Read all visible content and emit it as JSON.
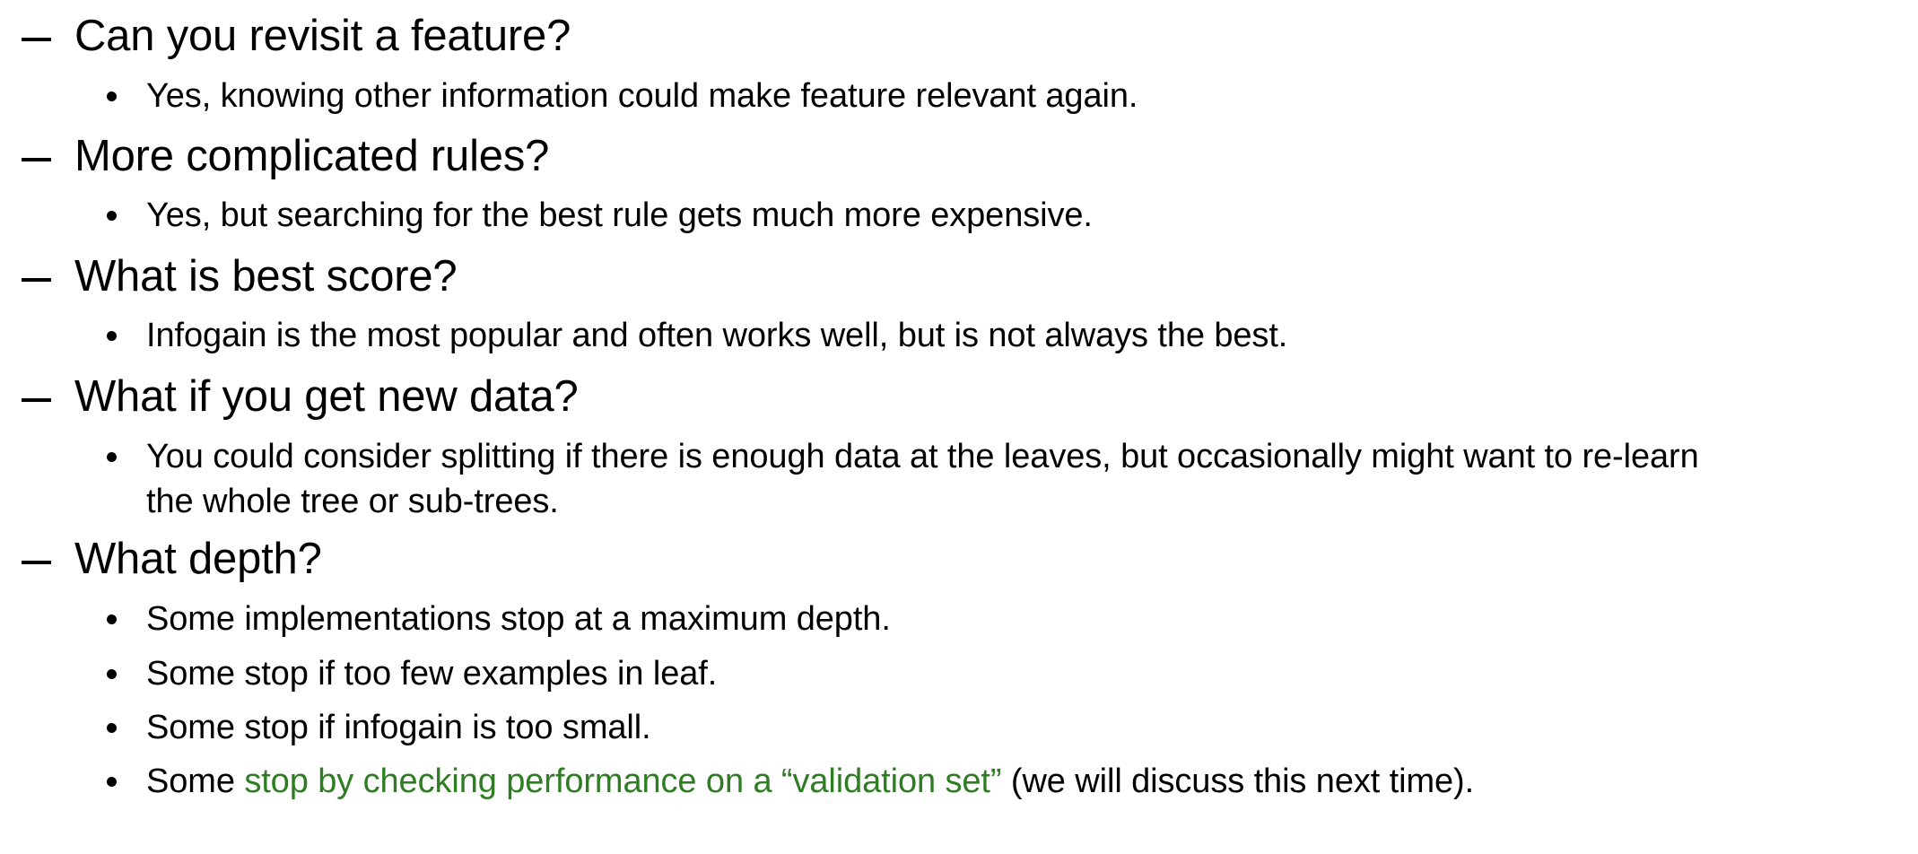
{
  "items": [
    {
      "question": "Can you revisit a feature?",
      "answers": [
        "Yes, knowing other information could make feature relevant again."
      ]
    },
    {
      "question": "More complicated rules?",
      "answers": [
        "Yes, but searching for the best rule gets much more expensive."
      ]
    },
    {
      "question": "What is best score?",
      "answers": [
        "Infogain is the most popular and often works well, but is not always the best."
      ]
    },
    {
      "question": "What if you get new data?",
      "answers": [
        "You could consider splitting if there is enough data at the leaves, but occasionally might want to re-learn",
        "the whole tree or sub-trees."
      ]
    },
    {
      "question": "What depth?",
      "answers": [
        "Some implementations stop at a maximum depth.",
        "Some stop if too few examples in leaf.",
        "Some stop if infogain is too small."
      ],
      "last_answer": {
        "prefix": "Some ",
        "highlight": "stop by checking performance on a “validation set”",
        "suffix": " (we will discuss this next time).",
        "highlight_color": "#2e7d22"
      }
    }
  ]
}
